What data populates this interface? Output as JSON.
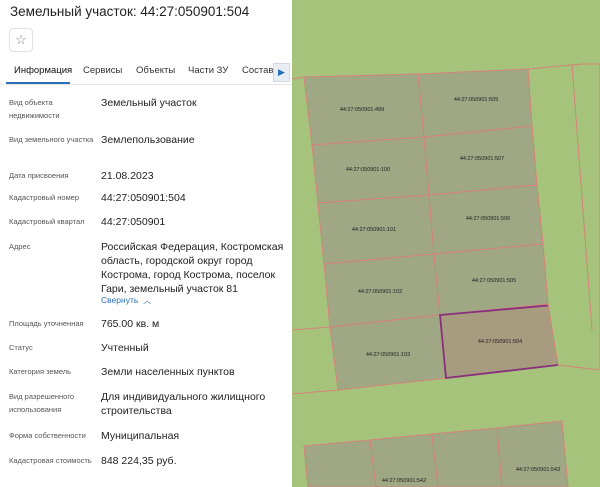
{
  "header": {
    "title": "Земельный участок: 44:27:050901:504",
    "favorite_icon": "star-icon"
  },
  "tabs": [
    {
      "label": "Информация",
      "active": true
    },
    {
      "label": "Сервисы",
      "active": false
    },
    {
      "label": "Объекты",
      "active": false
    },
    {
      "label": "Части ЗУ",
      "active": false
    },
    {
      "label": "Состав",
      "active": false
    }
  ],
  "tabs_scroll_icon": "chevron-right-icon",
  "fields": [
    {
      "label": "Вид объекта недвижимости",
      "value": "Земельный участок"
    },
    {
      "label": "Вид земельного участка",
      "value": "Землепользование"
    },
    {
      "label": "Дата присвоения",
      "value": "21.08.2023"
    },
    {
      "label": "Кадастровый номер",
      "value": "44:27:050901:504"
    },
    {
      "label": "Кадастровый квартал",
      "value": "44:27:050901"
    },
    {
      "label": "Адрес",
      "value": "Российская Федерация, Костромская область, городской округ город Кострома, город Кострома, поселок Гари, земельный участок 81"
    },
    {
      "label": "Площадь уточненная",
      "value": "765.00 кв. м"
    },
    {
      "label": "Статус",
      "value": "Учтенный"
    },
    {
      "label": "Категория земель",
      "value": "Земли населенных пунктов"
    },
    {
      "label": "Вид разрешенного использования",
      "value": "Для индивидуального жилищного строительства"
    },
    {
      "label": "Форма собственности",
      "value": "Муниципальная"
    },
    {
      "label": "Кадастровая стоимость",
      "value": "848 224,35 руб."
    }
  ],
  "collapse_link": "Свернуть",
  "map": {
    "colors": {
      "background": "#a5c37a",
      "parcel": "#a0a784",
      "selected_fill": "#a79c7f",
      "selected_border": "#8a2f7e",
      "boundary": "#d4837a"
    },
    "parcels": [
      {
        "label": "44:27:050901:499"
      },
      {
        "label": "44:27:050901:509"
      },
      {
        "label": "44:27:050901:100"
      },
      {
        "label": "44:27:050901:507"
      },
      {
        "label": "44:27:050901:101"
      },
      {
        "label": "44:27:050901:506"
      },
      {
        "label": "44:27:050901:102"
      },
      {
        "label": "44:27:050901:505"
      },
      {
        "label": "44:27:050901:103"
      },
      {
        "label": "44:27:050901:504",
        "selected": true
      },
      {
        "label": "44:27:050901:543"
      },
      {
        "label": "44:27:050901:542"
      }
    ]
  }
}
